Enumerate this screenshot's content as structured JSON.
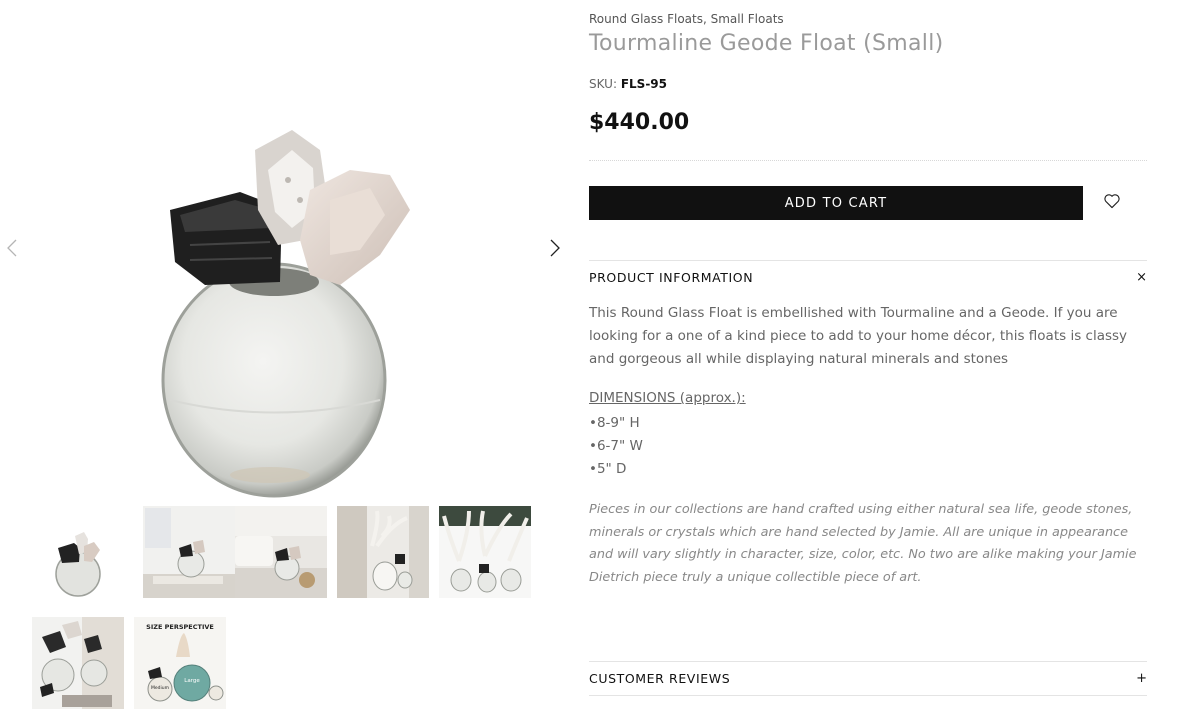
{
  "gallery": {
    "prev_icon": "chevron-left-icon",
    "next_icon": "chevron-right-icon",
    "main_image": "glass-float-with-tourmaline-and-geode",
    "thumbnails": [
      {
        "name": "thumb-product",
        "selected": true
      },
      {
        "name": "thumb-coffee-table-books"
      },
      {
        "name": "thumb-living-room"
      },
      {
        "name": "thumb-antler-room"
      },
      {
        "name": "thumb-antlers-group"
      },
      {
        "name": "thumb-collection-group"
      },
      {
        "name": "thumb-size-perspective",
        "caption": "SIZE PERSPECTIVE",
        "labels": [
          "Large",
          "Medium"
        ]
      }
    ]
  },
  "product": {
    "breadcrumb": [
      "Round Glass Floats",
      "Small Floats"
    ],
    "breadcrumb_sep": ", ",
    "title": "Tourmaline Geode Float (Small)",
    "sku_label": "SKU:",
    "sku": "FLS-95",
    "price": "$440.00",
    "add_to_cart": "ADD TO CART",
    "wishlist_icon": "heart-icon"
  },
  "info": {
    "title": "PRODUCT INFORMATION",
    "toggle": "×",
    "description": "This Round Glass Float is embellished with Tourmaline and a Geode. If you are looking for a one of a kind piece to add to your home décor, this floats is classy and gorgeous all while displaying natural minerals and stones",
    "dimensions_title": "DIMENSIONS (approx.):",
    "dimensions": [
      "•8-9\" H",
      "•6-7\" W",
      "•5\" D"
    ],
    "note": "Pieces in our collections are hand crafted using either natural sea life, geode stones, minerals or crystals which are hand selected by Jamie. All are unique in appearance and will vary slightly in character, size, color, etc. No two are alike making your Jamie Dietrich piece truly a unique collectible piece of art."
  },
  "reviews": {
    "title": "CUSTOMER REVIEWS",
    "toggle": "+"
  },
  "colors": {
    "button": "#111111",
    "title": "#9a9a9a",
    "text": "#666666"
  }
}
